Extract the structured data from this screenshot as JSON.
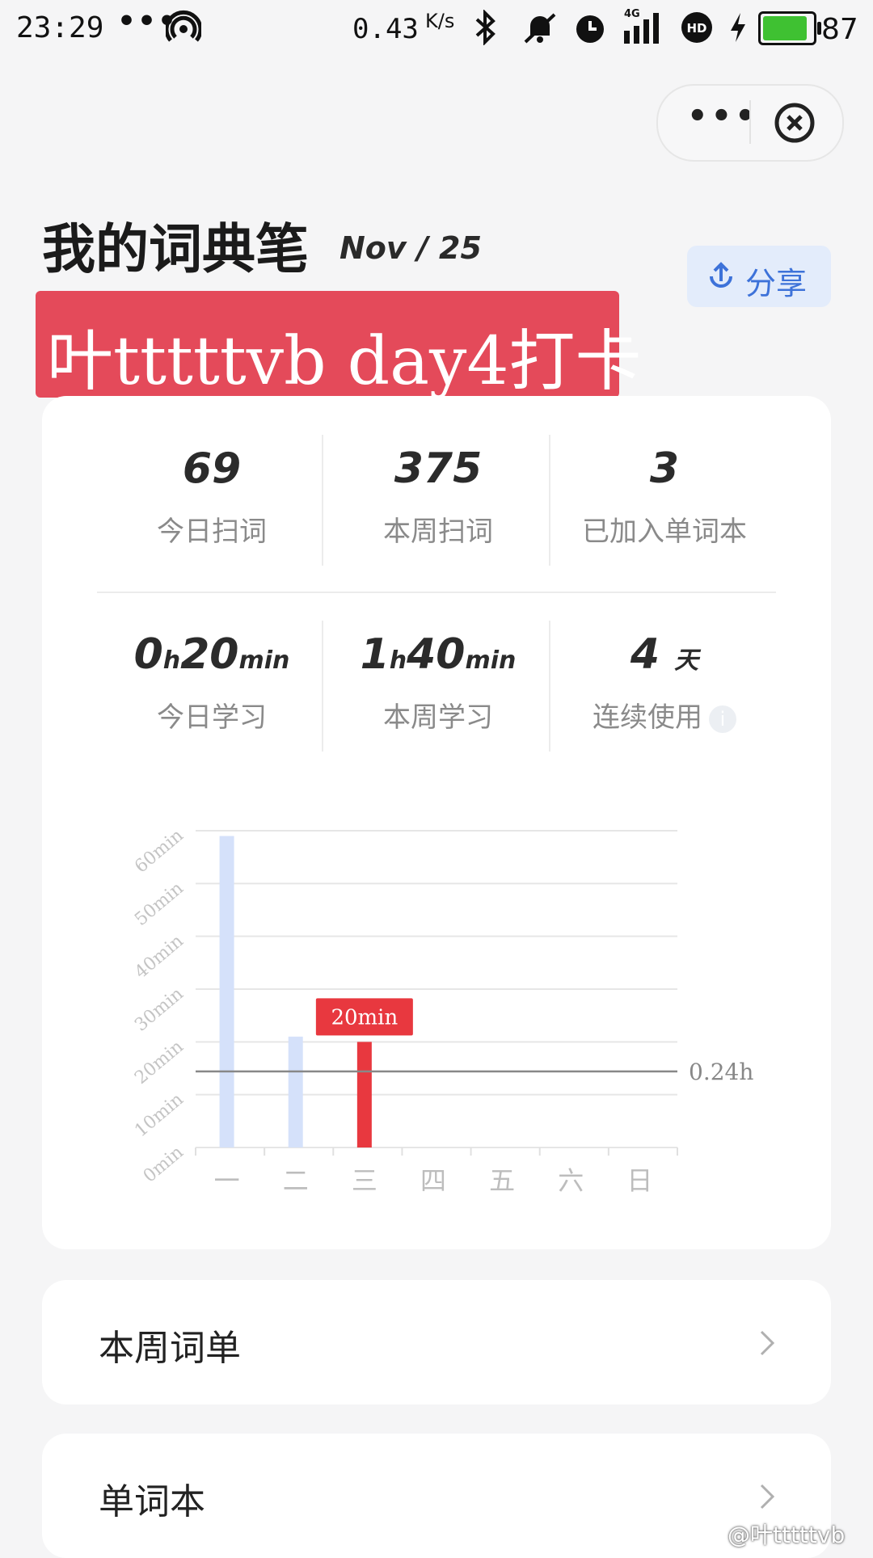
{
  "status_bar": {
    "time": "23:29",
    "overflow": "•••",
    "net_speed": "0.43",
    "net_speed_unit": "K/s",
    "network": "4G",
    "battery_percent": "87",
    "icons": [
      "hotspot-icon",
      "bluetooth-icon",
      "mute-icon",
      "alarm-icon",
      "signal-icon",
      "hd-icon",
      "charging-icon",
      "battery-icon"
    ]
  },
  "capsule": {
    "more_label": "•••",
    "close_icon": "close-icon"
  },
  "header": {
    "title": "我的词典笔",
    "date": "Nov / 25",
    "share_label": "分享",
    "share_icon": "upload-icon"
  },
  "banner": {
    "text": "叶tttttvb day4打卡",
    "color": "#e44a5a"
  },
  "stats": {
    "row1": [
      {
        "value": "69",
        "label": "今日扫词"
      },
      {
        "value": "375",
        "label": "本周扫词"
      },
      {
        "value": "3",
        "label": "已加入单词本"
      }
    ],
    "row2": [
      {
        "value_parts": [
          "0",
          "h",
          "20",
          "min"
        ],
        "label": "今日学习"
      },
      {
        "value_parts": [
          "1",
          "h",
          "40",
          "min"
        ],
        "label": "本周学习"
      },
      {
        "value_parts": [
          "4",
          "天"
        ],
        "label": "连续使用"
      }
    ],
    "info_icon": "info-icon"
  },
  "chart_data": {
    "type": "bar",
    "categories": [
      "一",
      "二",
      "三",
      "四",
      "五",
      "六",
      "日"
    ],
    "values": [
      59,
      21,
      20,
      0,
      0,
      0,
      0
    ],
    "highlight_index": 2,
    "highlight_label": "20min",
    "y_ticks": [
      "0min",
      "10min",
      "20min",
      "30min",
      "40min",
      "50min",
      "60min"
    ],
    "ylim": [
      0,
      60
    ],
    "reference_line": {
      "value": 14.4,
      "label": "0.24h"
    },
    "grid": true,
    "colors": {
      "bar": "#d5e1fa",
      "highlight": "#e8383f",
      "reference": "#888888"
    }
  },
  "list": [
    {
      "label": "本周词单"
    },
    {
      "label": "单词本"
    }
  ],
  "watermark": "@叶tttttvb",
  "colors": {
    "accent_blue": "#3d72d9",
    "banner_red": "#e44a5a"
  }
}
